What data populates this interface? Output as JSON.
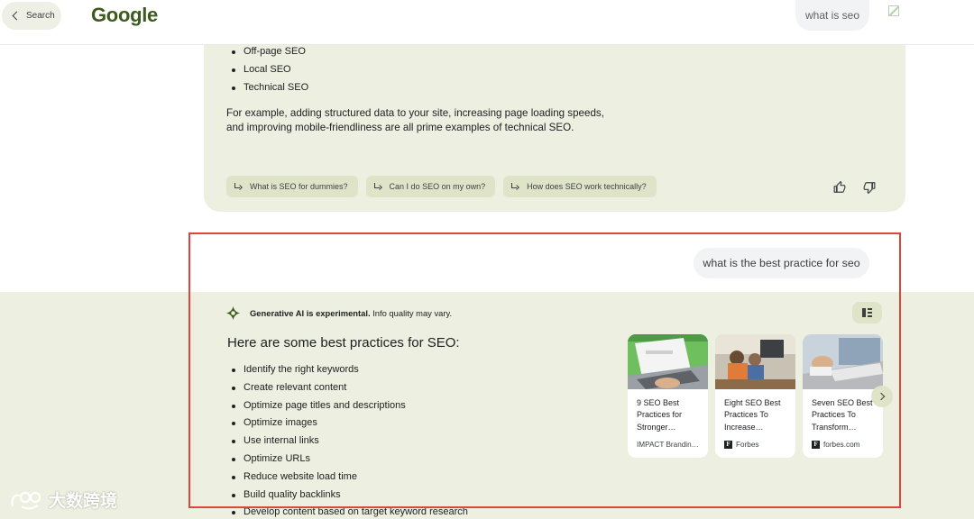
{
  "header": {
    "back_label": "Search",
    "logo": "Google",
    "query": "what is seo"
  },
  "previous_answer": {
    "list": [
      "Off-page SEO",
      "Local SEO",
      "Technical SEO"
    ],
    "paragraph": "For example, adding structured data to your site, increasing page loading speeds, and improving mobile-friendliness are all prime examples of technical SEO.",
    "followups": [
      "What is SEO for dummies?",
      "Can I do SEO on my own?",
      "How does SEO work technically?"
    ]
  },
  "user_query": "what is the best practice for seo",
  "ai_overview": {
    "note_bold": "Generative AI is experimental.",
    "note_rest": " Info quality may vary.",
    "heading": "Here are some best practices for SEO:",
    "items": [
      "Identify the right keywords",
      "Create relevant content",
      "Optimize page titles and descriptions",
      "Optimize images",
      "Use internal links",
      "Optimize URLs",
      "Reduce website load time",
      "Build quality backlinks",
      "Develop content based on target keyword research"
    ],
    "sources": [
      {
        "title": "9 SEO Best Practices for Stronger…",
        "site": "IMPACT Brandin…",
        "favicon": ""
      },
      {
        "title": "Eight SEO Best Practices To Increase…",
        "site": "Forbes",
        "favicon": "F"
      },
      {
        "title": "Seven SEO Best Practices To Transform…",
        "site": "forbes.com",
        "favicon": "F"
      }
    ]
  },
  "watermark": "大数跨境",
  "colors": {
    "panel_bg": "#edefe0",
    "chip_bg": "#dfe4c8",
    "logo": "#3d5a1e",
    "highlight": "#e0443a"
  },
  "icons": {
    "back": "chevron-left-icon",
    "followup": "arrow-reply-icon",
    "feedback": [
      "thumbs-up-icon",
      "thumbs-down-icon"
    ],
    "ai": "gemini-sparkle-icon",
    "layout": "layout-toggle-icon",
    "next": "chevron-right-icon"
  }
}
